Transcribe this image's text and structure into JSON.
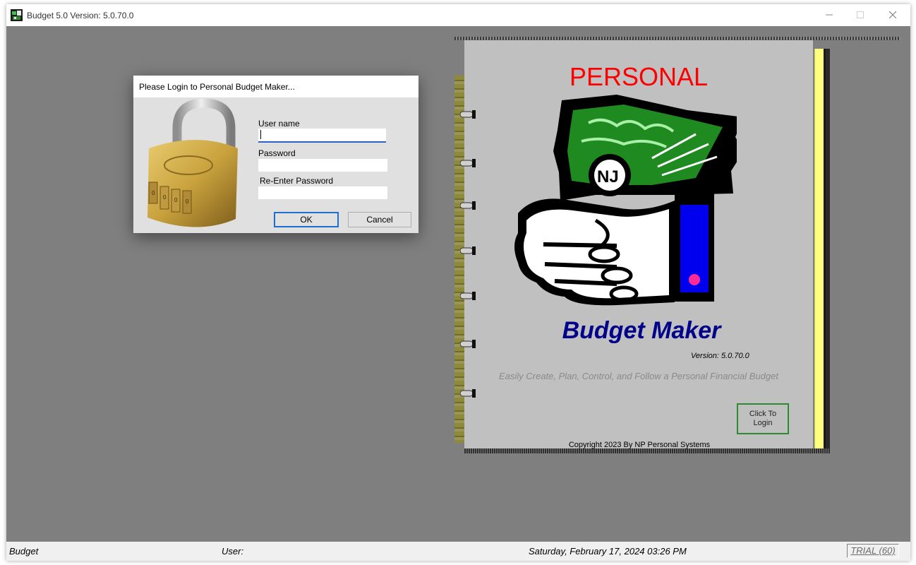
{
  "window": {
    "title": "Budget 5.0 Version: 5.0.70.0",
    "controls": {
      "minimize": "minimize-icon",
      "maximize": "maximize-icon",
      "close": "close-icon"
    }
  },
  "login_dialog": {
    "title": "Please Login to Personal Budget Maker...",
    "username_label": "User name",
    "username_value": "",
    "password_label": "Password",
    "password_value": "",
    "reenter_label": "Re-Enter Password",
    "reenter_value": "",
    "ok_label": "OK",
    "cancel_label": "Cancel",
    "image": "padlock-icon"
  },
  "splash": {
    "heading": "PERSONAL",
    "title": "Budget Maker",
    "version": "Version: 5.0.70.0",
    "tagline": "Easily Create, Plan, Control, and Follow a Personal Financial Budget",
    "login_button": "Click To Login",
    "copyright": "Copyright 2023 By NP Personal Systems",
    "image": "hand-holding-money-icon",
    "colors": {
      "heading": "#ff0000",
      "title": "#00008b",
      "cover": "#c0c0c0",
      "page_edge": "#ffff80",
      "button_border": "#2e8b2e"
    }
  },
  "statusbar": {
    "app": "Budget",
    "user": "User:",
    "datetime": "Saturday, February 17, 2024  03:26 PM",
    "trial": "TRIAL (60)"
  },
  "colors": {
    "background": "#7f7f7f",
    "accent": "#1f6fcf"
  }
}
